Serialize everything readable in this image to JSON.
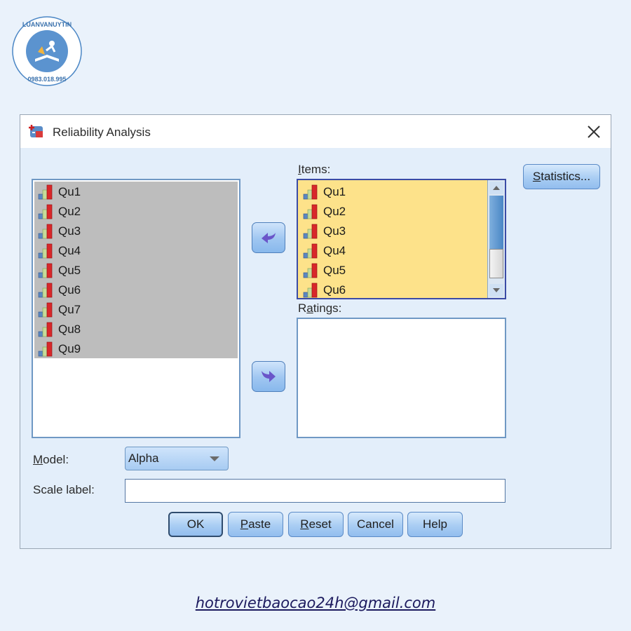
{
  "branding": {
    "logo_text": "LUANVANUYTIN",
    "logo_phone": "0983.018.995",
    "email": "hotrovietbaocao24h@gmail.com"
  },
  "dialog": {
    "title": "Reliability Analysis",
    "close_icon": "close-icon",
    "source_list": {
      "items": [
        "Qu1",
        "Qu2",
        "Qu3",
        "Qu4",
        "Qu5",
        "Qu6",
        "Qu7",
        "Qu8",
        "Qu9"
      ],
      "icon": "scale-variable-icon",
      "all_selected": true
    },
    "move_left_icon": "arrow-left-icon",
    "move_right_icon": "arrow-right-icon",
    "items_label_mnemonic": "I",
    "items_label_rest": "tems:",
    "items_list": {
      "visible_items": [
        "Qu1",
        "Qu2",
        "Qu3",
        "Qu4",
        "Qu5",
        "Qu6"
      ]
    },
    "ratings_label_pre": "R",
    "ratings_label_mnemonic": "a",
    "ratings_label_rest": "tings:",
    "ratings_list": {
      "items": []
    },
    "statistics_mnemonic": "S",
    "statistics_rest": "tatistics...",
    "model_label_mnemonic": "M",
    "model_label_rest": "odel:",
    "model_value": "Alpha",
    "scale_label": "Scale label:",
    "scale_label_value": "",
    "buttons": {
      "ok": "OK",
      "paste_mnemonic": "P",
      "paste_rest": "aste",
      "reset_mnemonic": "R",
      "reset_rest": "eset",
      "cancel": "Cancel",
      "help": "Help"
    }
  },
  "colors": {
    "background": "#eaf2fb",
    "dialog_bg": "#e3eefa",
    "selected_source_bg": "#bdbdbd",
    "items_list_bg": "#fde28a",
    "button_blue": "#a9cdf3"
  }
}
